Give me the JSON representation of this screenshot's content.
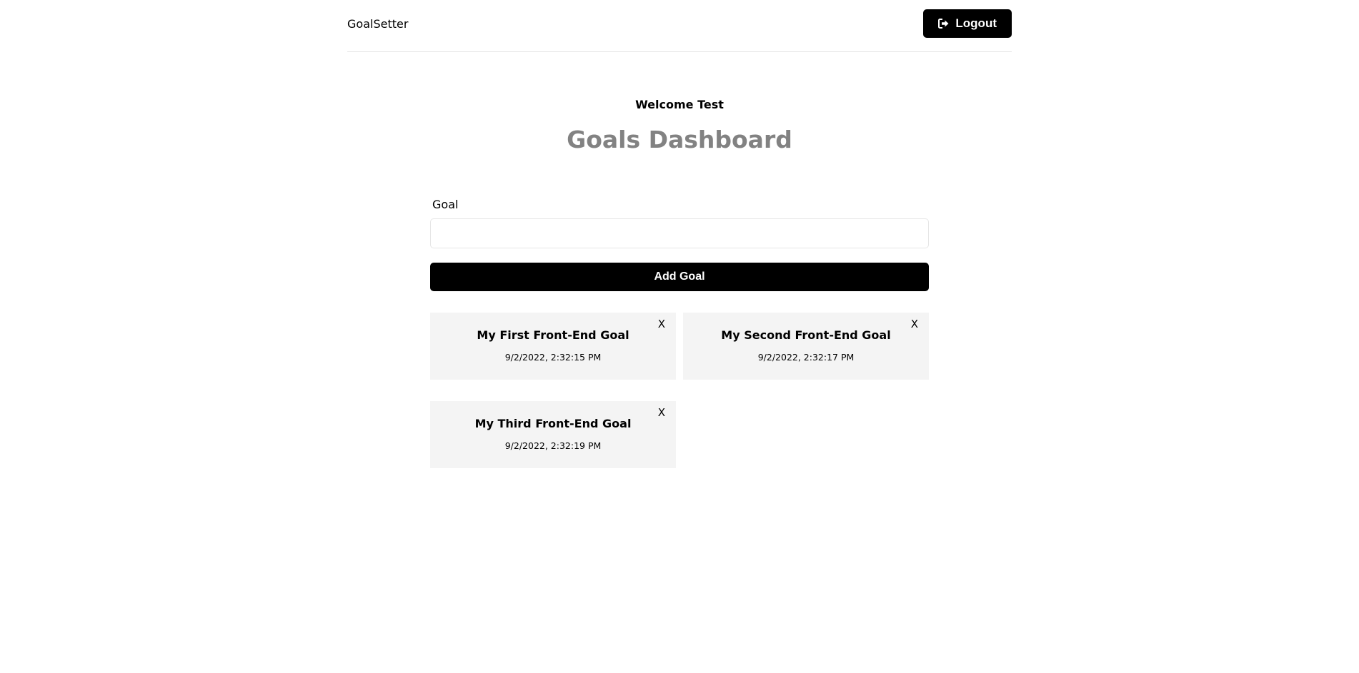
{
  "header": {
    "brand": "GoalSetter",
    "logout_label": "Logout"
  },
  "heading": {
    "welcome": "Welcome Test",
    "title": "Goals Dashboard"
  },
  "form": {
    "label": "Goal",
    "input_value": "",
    "input_placeholder": "",
    "submit_label": "Add Goal"
  },
  "goals": [
    {
      "text": "My First Front-End Goal",
      "date": "9/2/2022, 2:32:15 PM",
      "close": "X"
    },
    {
      "text": "My Second Front-End Goal",
      "date": "9/2/2022, 2:32:17 PM",
      "close": "X"
    },
    {
      "text": "My Third Front-End Goal",
      "date": "9/2/2022, 2:32:19 PM",
      "close": "X"
    }
  ]
}
